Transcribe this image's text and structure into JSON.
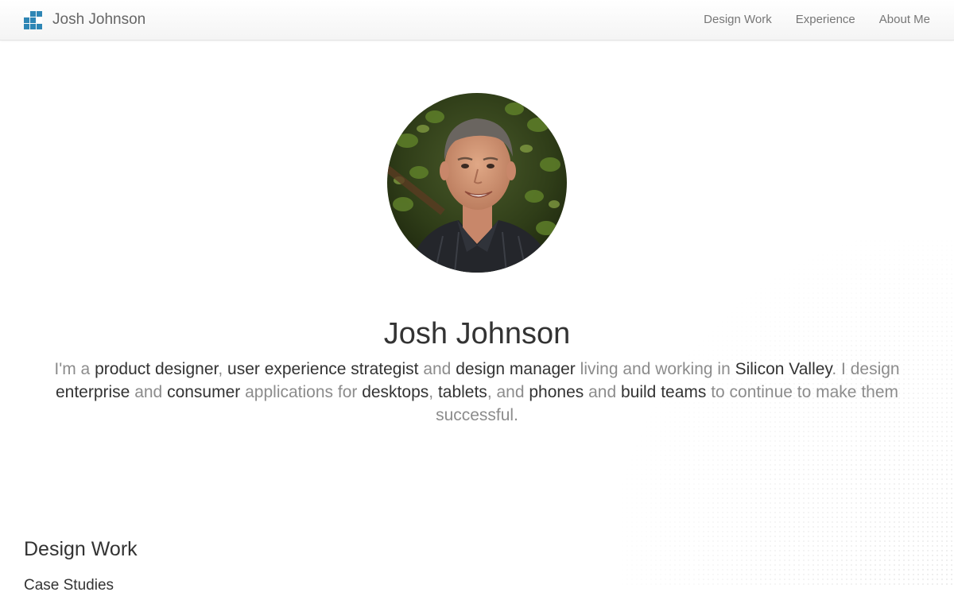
{
  "header": {
    "brand_name": "Josh Johnson",
    "nav": [
      "Design Work",
      "Experience",
      "About Me"
    ]
  },
  "hero": {
    "avatar_icon": "profile-photo",
    "name": "Josh Johnson",
    "bio": [
      {
        "text": "I'm a ",
        "highlight": false
      },
      {
        "text": "product designer",
        "highlight": true
      },
      {
        "text": ", ",
        "highlight": false
      },
      {
        "text": "user experience strategist",
        "highlight": true
      },
      {
        "text": " and ",
        "highlight": false
      },
      {
        "text": "design manager",
        "highlight": true
      },
      {
        "text": " living and working in ",
        "highlight": false
      },
      {
        "text": "Silicon Valley",
        "highlight": true
      },
      {
        "text": ". I design ",
        "highlight": false
      },
      {
        "text": "enterprise",
        "highlight": true
      },
      {
        "text": " and ",
        "highlight": false
      },
      {
        "text": "consumer",
        "highlight": true
      },
      {
        "text": " applications for ",
        "highlight": false
      },
      {
        "text": "desktops",
        "highlight": true
      },
      {
        "text": ", ",
        "highlight": false
      },
      {
        "text": "tablets",
        "highlight": true
      },
      {
        "text": ", and ",
        "highlight": false
      },
      {
        "text": "phones",
        "highlight": true
      },
      {
        "text": " and ",
        "highlight": false
      },
      {
        "text": "build teams",
        "highlight": true
      },
      {
        "text": " to continue to make them successful.",
        "highlight": false
      }
    ]
  },
  "design_work": {
    "title": "Design Work",
    "subtitle": "Case Studies"
  },
  "colors": {
    "logo_blue": "#2e86b5",
    "text_dark": "#333333",
    "text_muted": "#8c8c8c"
  }
}
